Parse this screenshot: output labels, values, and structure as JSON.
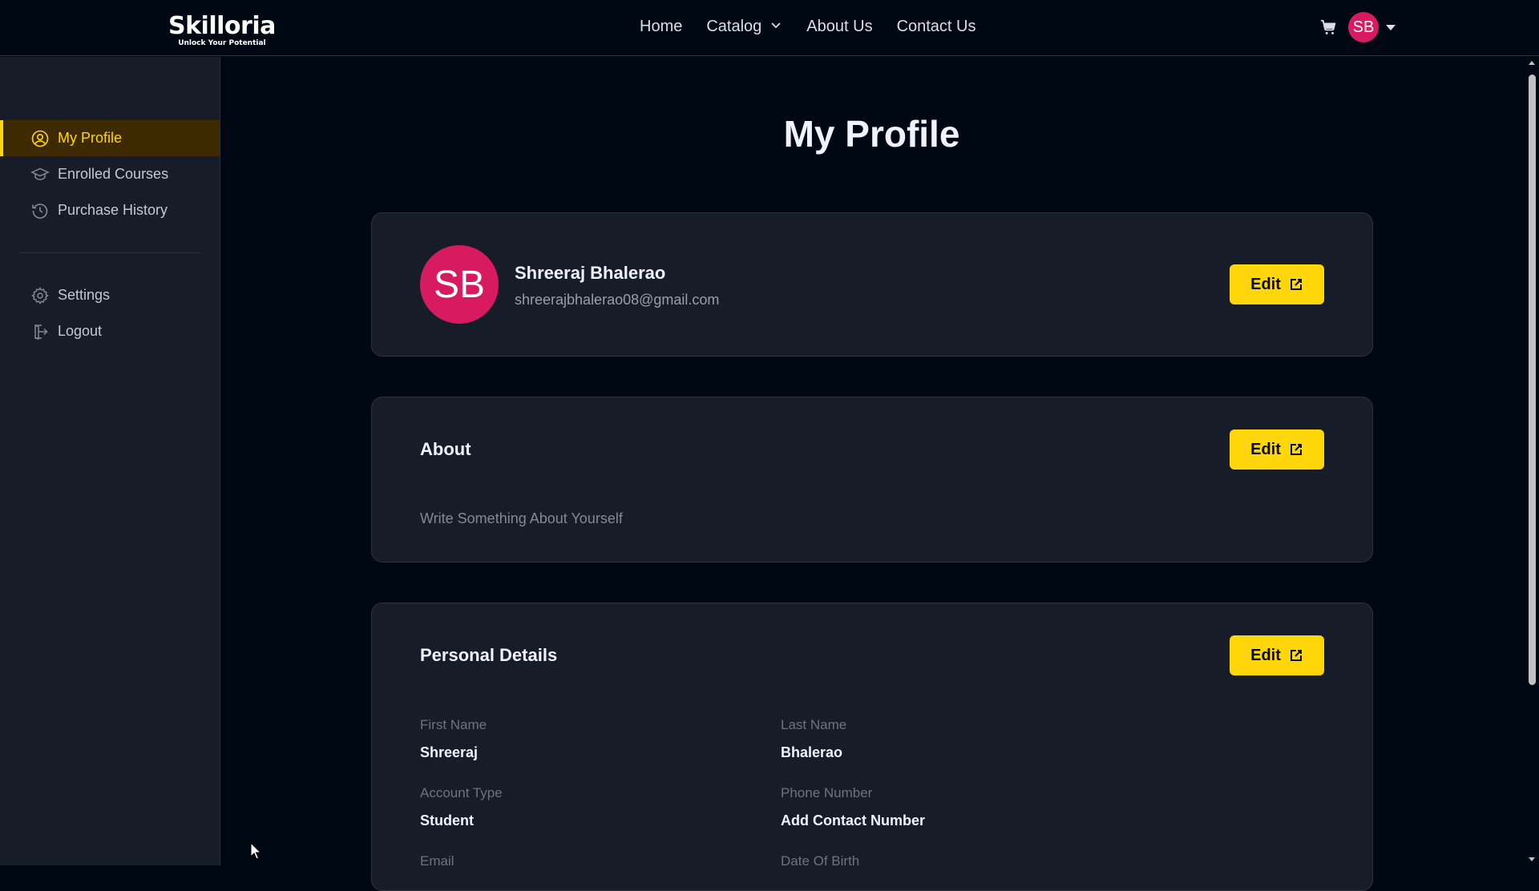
{
  "brand": {
    "name": "Skilloria",
    "tagline": "Unlock Your Potential"
  },
  "nav": {
    "links": [
      "Home",
      "Catalog",
      "About Us",
      "Contact Us"
    ],
    "avatar_initials": "SB"
  },
  "sidebar": {
    "items": [
      {
        "label": "My Profile",
        "icon": "user-circle-icon",
        "active": true
      },
      {
        "label": "Enrolled Courses",
        "icon": "graduation-cap-icon",
        "active": false
      },
      {
        "label": "Purchase History",
        "icon": "history-icon",
        "active": false
      }
    ],
    "bottom_items": [
      {
        "label": "Settings",
        "icon": "gear-icon"
      },
      {
        "label": "Logout",
        "icon": "logout-icon"
      }
    ]
  },
  "page": {
    "title": "My Profile"
  },
  "profile_card": {
    "initials": "SB",
    "name": "Shreeraj Bhalerao",
    "email": "shreerajbhalerao08@gmail.com",
    "edit_label": "Edit"
  },
  "about_card": {
    "heading": "About",
    "text": "Write Something About Yourself",
    "edit_label": "Edit"
  },
  "details_card": {
    "heading": "Personal Details",
    "edit_label": "Edit",
    "fields": [
      {
        "label": "First Name",
        "value": "Shreeraj"
      },
      {
        "label": "Last Name",
        "value": "Bhalerao"
      },
      {
        "label": "Account Type",
        "value": "Student"
      },
      {
        "label": "Phone Number",
        "value": "Add Contact Number"
      },
      {
        "label": "Email",
        "value": ""
      },
      {
        "label": "Date Of Birth",
        "value": ""
      }
    ]
  },
  "colors": {
    "background": "#000814",
    "sidebar": "#161d29",
    "accent_yellow": "#ffd60a",
    "avatar_pink": "#d81b60"
  }
}
